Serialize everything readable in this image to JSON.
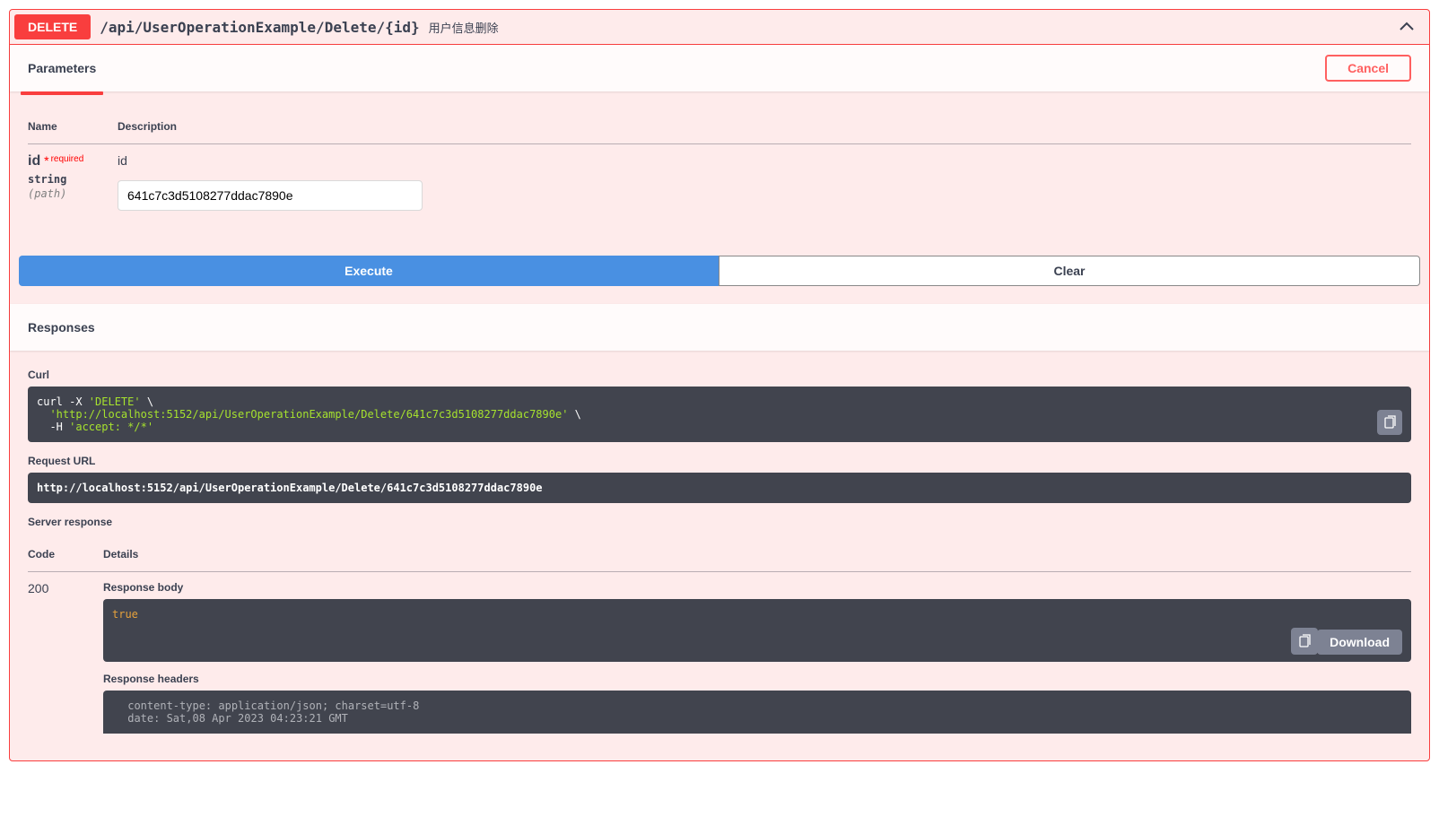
{
  "summary": {
    "method": "DELETE",
    "path": "/api/UserOperationExample/Delete/{id}",
    "description": "用户信息删除"
  },
  "tabs": {
    "parameters": "Parameters",
    "cancel": "Cancel"
  },
  "params_header": {
    "name": "Name",
    "description": "Description"
  },
  "param": {
    "name": "id",
    "required_star": "*",
    "required_text": "required",
    "type": "string",
    "in": "(path)",
    "desc": "id",
    "value": "641c7c3d5108277ddac7890e"
  },
  "buttons": {
    "execute": "Execute",
    "clear": "Clear"
  },
  "responses_heading": "Responses",
  "curl": {
    "heading": "Curl",
    "line1a": "curl -X ",
    "line1b": "'DELETE'",
    "line1c": " \\",
    "line2a": "  ",
    "line2b": "'http://localhost:5152/api/UserOperationExample/Delete/641c7c3d5108277ddac7890e'",
    "line2c": " \\",
    "line3a": "  -H ",
    "line3b": "'accept: */*'"
  },
  "request_url": {
    "heading": "Request URL",
    "value": "http://localhost:5152/api/UserOperationExample/Delete/641c7c3d5108277ddac7890e"
  },
  "server_response_heading": "Server response",
  "resp_header": {
    "code": "Code",
    "details": "Details"
  },
  "response": {
    "code": "200",
    "body_heading": "Response body",
    "body_value": "true",
    "download": "Download",
    "headers_heading": "Response headers",
    "headers_value": " content-type: application/json; charset=utf-8 \n date: Sat,08 Apr 2023 04:23:21 GMT "
  }
}
